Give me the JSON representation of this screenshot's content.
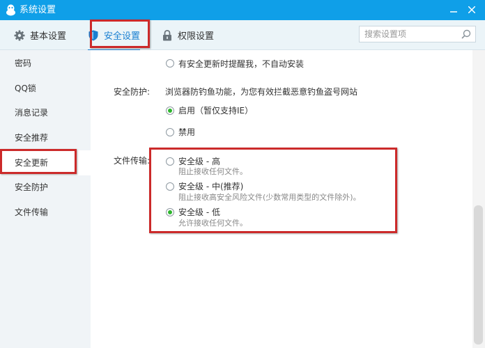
{
  "window": {
    "title": "系统设置",
    "minimize_icon": "minimize-icon",
    "close_icon": "close-icon"
  },
  "tabs": [
    {
      "label": "基本设置",
      "icon": "gear-icon"
    },
    {
      "label": "安全设置",
      "icon": "shield-icon",
      "selected": true
    },
    {
      "label": "权限设置",
      "icon": "lock-icon"
    }
  ],
  "search": {
    "placeholder": "搜索设置项",
    "value": "",
    "icon": "search-icon"
  },
  "sidebar": {
    "items": [
      {
        "label": "密码"
      },
      {
        "label": "QQ锁"
      },
      {
        "label": "消息记录"
      },
      {
        "label": "安全推荐"
      },
      {
        "label": "安全更新",
        "selected": true
      },
      {
        "label": "安全防护"
      },
      {
        "label": "文件传输"
      }
    ]
  },
  "update": {
    "option_remind": {
      "label": "有安全更新时提醒我，不自动安装",
      "checked": false
    }
  },
  "protection": {
    "label": "安全防护:",
    "description": "浏览器防钓鱼功能，为您有效拦截恶意钓鱼盗号网站",
    "options": [
      {
        "label": "启用（暂仅支持IE）",
        "checked": true
      },
      {
        "label": "禁用",
        "checked": false
      }
    ]
  },
  "file_transfer": {
    "label": "文件传输:",
    "options": [
      {
        "label": "安全级 - 高",
        "desc": "阻止接收任何文件。",
        "checked": false
      },
      {
        "label": "安全级 - 中(推荐)",
        "desc": "阻止接收高安全风险文件(少数常用类型的文件除外)。",
        "checked": false
      },
      {
        "label": "安全级 - 低",
        "desc": "允许接收任何文件。",
        "checked": true
      }
    ]
  },
  "colors": {
    "titlebar": "#0f9fe8",
    "accent": "#1a7fd1",
    "radio_checked": "#2db52d",
    "highlight": "#cc2a2a"
  }
}
